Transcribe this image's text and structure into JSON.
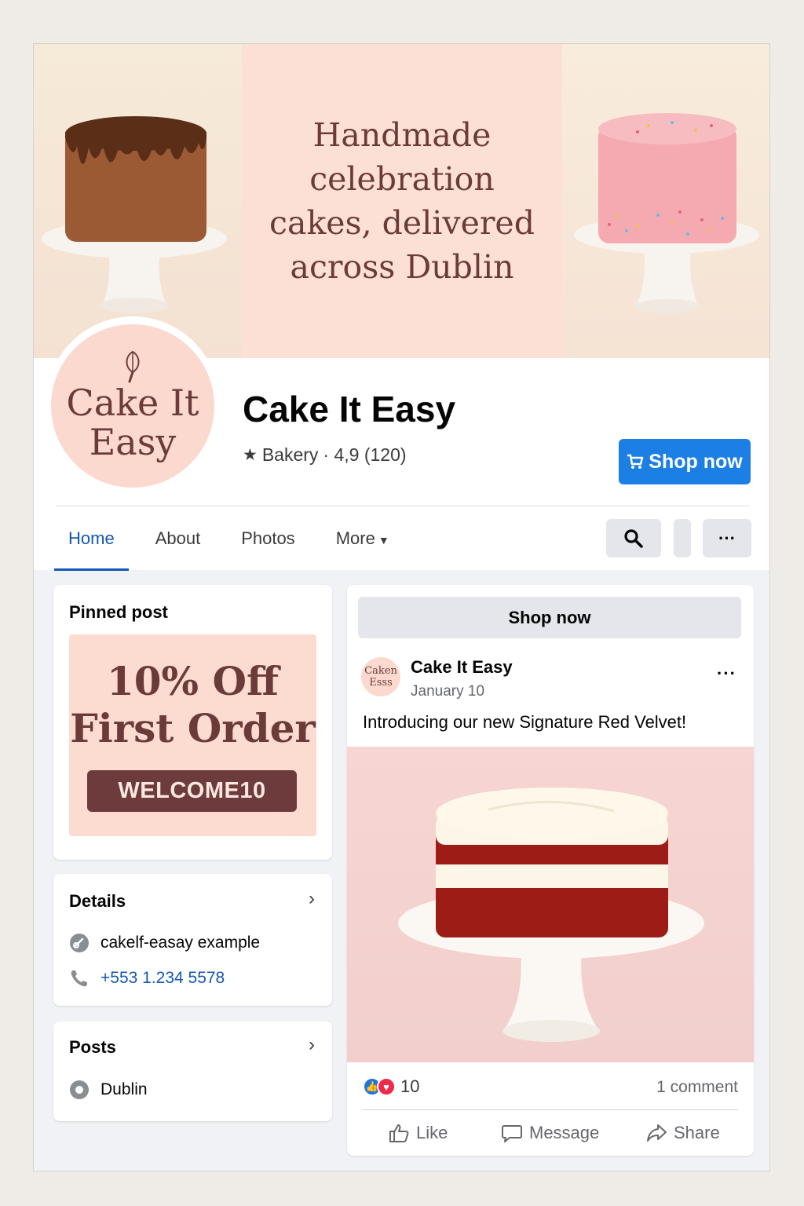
{
  "cover": {
    "headline": "Handmade celebration cakes, delivered across Dublin"
  },
  "profile": {
    "avatar_text_line1": "Cake It",
    "avatar_text_line2": "Easy",
    "name": "Cake It Easy",
    "category": "Bakery",
    "rating": "· 4,9 (120)",
    "shop_button": "Shop now"
  },
  "tabs": [
    {
      "label": "Home"
    },
    {
      "label": "About"
    },
    {
      "label": "Photos"
    },
    {
      "label": "More"
    }
  ],
  "tab_buttons": {
    "more_dots": "···"
  },
  "pinned": {
    "title": "Pinned post",
    "line1": "10% Off",
    "line2": "First Order",
    "code": "WELCOME10"
  },
  "details": {
    "title": "Details",
    "website": "cakelf-easay example",
    "phone": "+553 1.234 5578"
  },
  "posts_card": {
    "title": "Posts",
    "location": "Dublin"
  },
  "feed": {
    "shop_button": "Shop now",
    "avatar_line1": "Caken",
    "avatar_line2": "Esss",
    "author": "Cake It Easy",
    "date": "January 10",
    "more": "···",
    "text": "Introducing our new Signature Red Velvet!",
    "reaction_count": "10",
    "comments": "1 comment",
    "actions": {
      "like": "Like",
      "message": "Message",
      "share": "Share"
    }
  },
  "colors": {
    "accent": "#1b7fe3",
    "tab_active": "#1458b3",
    "brand_pink": "#fbd9cf",
    "brand_brown": "#6b3b3a"
  }
}
